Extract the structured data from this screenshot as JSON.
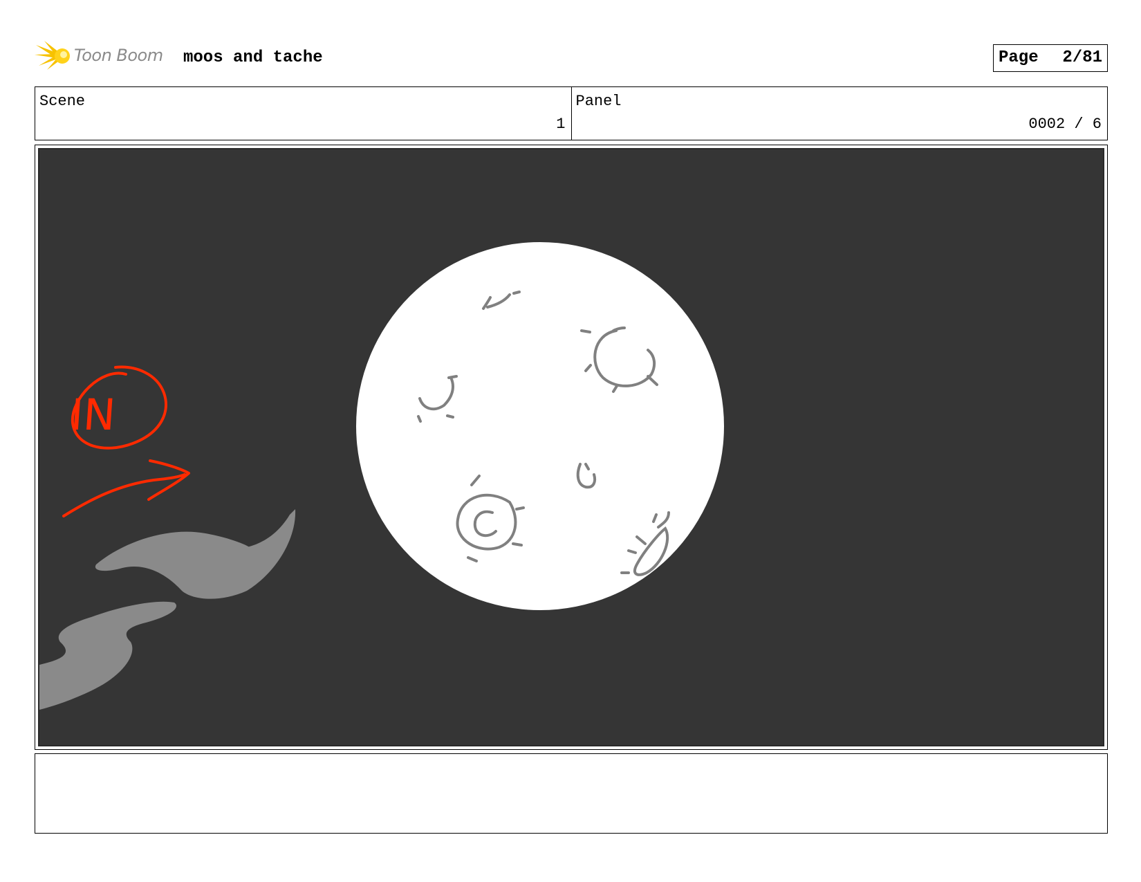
{
  "header": {
    "logo_text": "Toon Boom",
    "project_title": "moos and tache",
    "page_label": "Page",
    "page_number": "2/81"
  },
  "info": {
    "scene_label": "Scene",
    "scene_value": "1",
    "panel_label": "Panel",
    "panel_value": "0002 / 6"
  },
  "artwork": {
    "annotation_text": "IN",
    "colors": {
      "background": "#353535",
      "moon": "#ffffff",
      "crater": "#808080",
      "annotation": "#ff2a00",
      "cloud": "#8a8a8a"
    }
  },
  "notes": {
    "text": ""
  }
}
